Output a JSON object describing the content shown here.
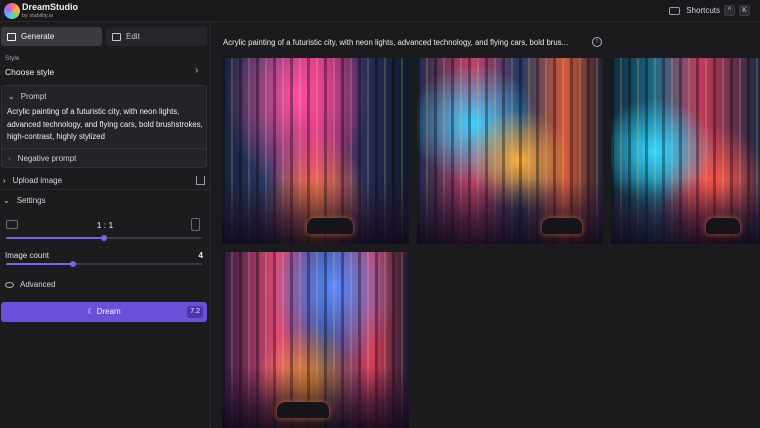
{
  "header": {
    "brand": "DreamStudio",
    "brand_sub": "by stability.ai",
    "shortcuts_label": "Shortcuts",
    "keys": [
      "^",
      "K"
    ]
  },
  "sidebar": {
    "tabs": [
      {
        "label": "Generate",
        "active": true
      },
      {
        "label": "Edit",
        "active": false
      }
    ],
    "style_label": "Style",
    "style_value": "Choose style",
    "prompt_label": "Prompt",
    "prompt_text": "Acrylic painting of a futuristic city, with neon lights, advanced technology, and flying cars, bold brushstrokes, high-contrast, highly stylized",
    "negative_prompt_label": "Negative prompt",
    "upload_label": "Upload image",
    "settings_label": "Settings",
    "aspect_ratio": "1 : 1",
    "aspect_slider_fraction": 0.5,
    "image_count_label": "Image count",
    "image_count_value": "4",
    "image_count_slider_fraction": 0.34,
    "advanced_label": "Advanced",
    "dream_label": "Dream",
    "dream_cost": "7.2"
  },
  "main": {
    "prompt_title": "Acrylic painting of a futuristic city, with neon lights, advanced technology, and flying cars, bold brus..."
  },
  "colors": {
    "accent": "#6b4fd8",
    "slider": "#7a63e6",
    "background": "#1b1b1e"
  }
}
